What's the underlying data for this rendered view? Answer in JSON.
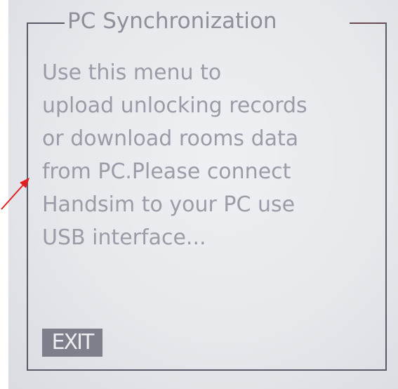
{
  "dialog": {
    "title": "PC Synchronization",
    "message_lines": [
      "Use this menu to",
      "upload unlocking records",
      "or download rooms data",
      "from PC.Please connect",
      "Handsim to your PC use",
      "USB interface..."
    ],
    "exit_label": "EXIT"
  },
  "colors": {
    "text": "#9a9ca8",
    "border": "#5a5a66",
    "button_bg": "#7d7f8a",
    "arrow": "#e02020"
  }
}
